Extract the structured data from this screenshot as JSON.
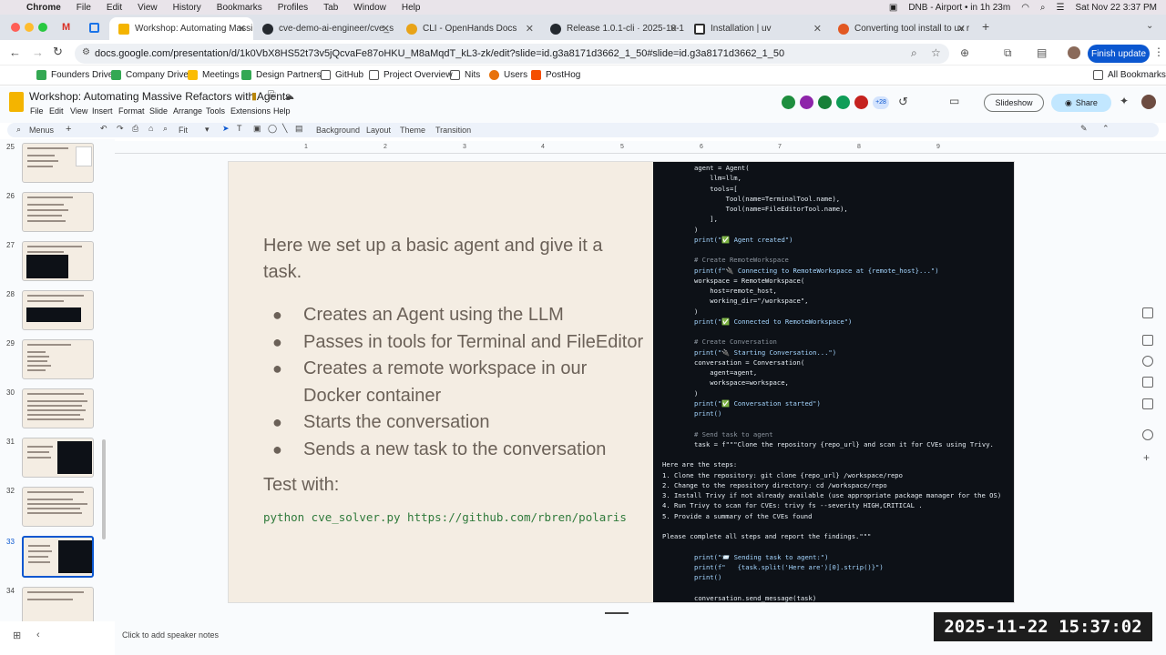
{
  "mac_menu": {
    "app": "Chrome",
    "items": [
      "File",
      "Edit",
      "View",
      "History",
      "Bookmarks",
      "Profiles",
      "Tab",
      "Window",
      "Help"
    ],
    "status_dnb": "DNB - Airport • in 1h 23m",
    "datetime": "Sat Nov 22  3:37 PM"
  },
  "tabs": [
    {
      "title": "Workshop: Automating Massi",
      "color": "#f4b400"
    },
    {
      "title": "cve-demo-ai-engineer/cve_s",
      "color": "#24292f"
    },
    {
      "title": "CLI - OpenHands Docs",
      "color": "#e8a317"
    },
    {
      "title": "Release 1.0.1-cli · 2025-10-1",
      "color": "#24292f"
    },
    {
      "title": "Installation | uv",
      "color": "#2f2f2f"
    },
    {
      "title": "Converting tool install to uv r",
      "color": "#e25822"
    }
  ],
  "address": {
    "url": "docs.google.com/presentation/d/1k0VbX8HS52t73v5jQcvaFe87oHKU_M8aMqdT_kL3-zk/edit?slide=id.g3a8171d3662_1_50#slide=id.g3a8171d3662_1_50",
    "finish_update": "Finish update"
  },
  "bookmarks": {
    "items": [
      "Founders Drive",
      "Company Drive",
      "Meetings",
      "Design Partners",
      "GitHub",
      "Project Overview",
      "Nits",
      "Users",
      "PostHog"
    ],
    "all": "All Bookmarks"
  },
  "doc": {
    "title": "Workshop: Automating Massive Refactors with Agents",
    "menus": [
      "File",
      "Edit",
      "View",
      "Insert",
      "Format",
      "Slide",
      "Arrange",
      "Tools",
      "Extensions",
      "Help"
    ],
    "collab_count": "+28",
    "slideshow": "Slideshow",
    "share": "Share"
  },
  "slide_toolbar": {
    "menus": "Menus",
    "zoom": "Fit",
    "background": "Background",
    "layout": "Layout",
    "theme": "Theme",
    "transition": "Transition"
  },
  "ruler": [
    "1",
    "2",
    "3",
    "4",
    "5",
    "6",
    "7",
    "8",
    "9"
  ],
  "thumbnails": [
    "25",
    "26",
    "27",
    "28",
    "29",
    "30",
    "31",
    "32",
    "33",
    "34"
  ],
  "slide": {
    "intro": "Here we set up a basic agent and give it a task.",
    "bullets": [
      "Creates an Agent using the LLM",
      "Passes in tools for Terminal and FileEditor",
      "Creates a remote workspace in our Docker container",
      "Starts the conversation",
      "Sends a new task to the conversation"
    ],
    "test_label": "Test with:",
    "command": "python cve_solver.py https://github.com/rbren/polaris",
    "code_lines": [
      "agent = Agent(",
      "    llm=llm,",
      "    tools=[",
      "        Tool(name=TerminalTool.name),",
      "        Tool(name=FileEditorTool.name),",
      "    ],",
      ")",
      "print(\"✅ Agent created\")",
      "",
      "# Create RemoteWorkspace",
      "print(f\"🔌 Connecting to RemoteWorkspace at {remote_host}...\")",
      "workspace = RemoteWorkspace(",
      "    host=remote_host,",
      "    working_dir=\"/workspace\",",
      ")",
      "print(\"✅ Connected to RemoteWorkspace\")",
      "",
      "# Create Conversation",
      "print(\"🔌 Starting Conversation...\")",
      "conversation = Conversation(",
      "    agent=agent,",
      "    workspace=workspace,",
      ")",
      "print(\"✅ Conversation started\")",
      "print()",
      "",
      "# Send task to agent",
      "task = f\"\"\"Clone the repository {repo_url} and scan it for CVEs using Trivy.",
      "",
      "Here are the steps:",
      "1. Clone the repository: git clone {repo_url} /workspace/repo",
      "2. Change to the repository directory: cd /workspace/repo",
      "3. Install Trivy if not already available (use appropriate package manager for the OS)",
      "4. Run Trivy to scan for CVEs: trivy fs --severity HIGH,CRITICAL .",
      "5. Provide a summary of the CVEs found",
      "",
      "Please complete all steps and report the findings.\"\"\"",
      "",
      "print(\"📨 Sending task to agent:\")",
      "print(f\"   {task.split('Here are')[0].strip()}\")",
      "print()",
      "",
      "conversation.send_message(task)"
    ]
  },
  "notes_placeholder": "Click to add speaker notes",
  "timestamp": "2025-11-22 15:37:02"
}
